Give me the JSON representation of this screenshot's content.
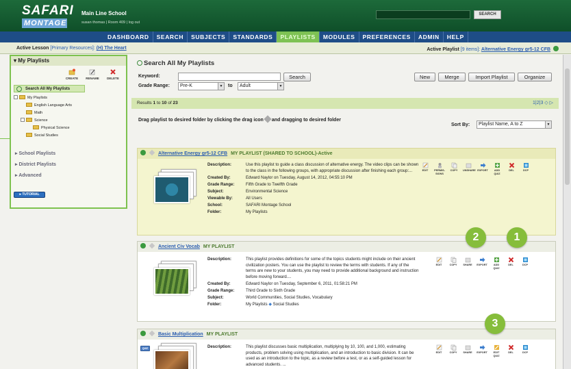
{
  "header": {
    "logo_top": "SAFARI",
    "logo_bottom": "MONTAGE",
    "school": "Main Line School",
    "userline": "susan thomas | Room 409 | log out",
    "search_button": "SEARCH"
  },
  "nav": [
    "DASHBOARD",
    "SEARCH",
    "SUBJECTS",
    "STANDARDS",
    "PLAYLISTS",
    "MODULES",
    "PREFERENCES",
    "ADMIN",
    "HELP"
  ],
  "nav_active": "PLAYLISTS",
  "active_bar": {
    "lesson_label": "Active Lesson",
    "lesson_sub": "[Primary Resources]:",
    "lesson_link": "(H) The Heart",
    "playlist_label": "Active Playlist",
    "playlist_sub": "[9 items]:",
    "playlist_link": "Alternative Energy gr5-12 CFB"
  },
  "sidebar": {
    "title": "My Playlists",
    "tools": [
      "CREATE",
      "RENAME",
      "DELETE"
    ],
    "search_all": "Search All My Playlists",
    "tree": [
      "My Playlists",
      "English Language Arts",
      "Math",
      "Science",
      "Physical Science",
      "Social Studies"
    ],
    "sections": [
      "School Playlists",
      "District Playlists",
      "Advanced"
    ],
    "tutorial": "TUTORIAL"
  },
  "main": {
    "title": "Search All My Playlists",
    "keyword_label": "Keyword:",
    "keyword_value": "",
    "search_btn": "Search",
    "grade_label": "Grade Range:",
    "grade_from": "Pre-K",
    "to_label": "to",
    "grade_to": "Adult",
    "buttons": [
      "New",
      "Merge",
      "Import Playlist",
      "Organize"
    ],
    "results_pre": "Results",
    "results_range": "1",
    "results_to": "to",
    "results_end": "10",
    "results_of": "of",
    "results_total": "23",
    "pager": "1|2|3",
    "drag_text_1": "Drag playlist to desired folder by clicking the drag icon",
    "drag_text_2": "and dragging to desired folder",
    "sort_label": "Sort By:",
    "sort_value": "Playlist Name, A to Z"
  },
  "field_labels": [
    "Description:",
    "Created By:",
    "Grade Range:",
    "Subject:",
    "Viewable By:",
    "School:",
    "Folder:"
  ],
  "playlists": [
    {
      "title": "Alternative Energy gr5-12 CFB",
      "meta": "MY PLAYLIST (SHARED TO SCHOOL)-Active",
      "description": "Use this playlist to guide a class discussion of alternative energy. The video clips can be shown to the class in the following groups, with appropriate discussion after finishing each group:...",
      "created_by": "Edward Naylor on Tuesday, August 14, 2012, 04:55:10 PM",
      "grade_range": "Fifth Grade to Twelfth Grade",
      "subject": "Environmental Science",
      "viewable_by": "All Users",
      "school": "SAFARI Montage School",
      "folder": "My Playlists",
      "actions": [
        "EDIT",
        "PERMIS-SIONS",
        "COPY",
        "UNSHARE",
        "EXPORT",
        "ADD QUIZ",
        "DEL",
        "DCP"
      ]
    },
    {
      "title": "Ancient Civ Vocab",
      "meta": "MY PLAYLIST",
      "description": "This playlist provides definitions for some of the topics students might include on their ancient civilization posters. You can use the playlist to review the terms with students. If any of the terms are new to your students, you may need to provide additional background and instruction before moving forward....",
      "created_by": "Edward Naylor on Tuesday, September 6, 2011, 01:58:21 PM",
      "grade_range": "Third Grade to Sixth Grade",
      "subject": "World Communities, Social Studies, Vocabulary",
      "folder": "My Playlists",
      "folder_sub": "Social Studies",
      "actions": [
        "EDIT",
        "COPY",
        "SHARE",
        "EXPORT",
        "ADD QUIZ",
        "DEL",
        "DCP"
      ]
    },
    {
      "title": "Basic Multiplication",
      "meta": "MY PLAYLIST",
      "description": "This playlist discusses basic multiplication, multiplying by 10, 100, and 1,000, estimating products, problem solving using multiplication, and an introduction to basic division. It can be used as an introduction to the topic, as a review before a test, or as a self-guided lesson for advanced students. ...",
      "actions": [
        "EDIT",
        "COPY",
        "SHARE",
        "EXPORT",
        "EDIT QUIZ",
        "DEL",
        "DCP"
      ],
      "quiz_badge": "QUIZ"
    }
  ],
  "callouts": [
    "1",
    "2",
    "3"
  ],
  "colors": {
    "header_green": "#1d6a3a",
    "nav_blue": "#1e4d87",
    "active_tab": "#7ec254",
    "callout": "#86bd3b",
    "link": "#2a5db0"
  }
}
